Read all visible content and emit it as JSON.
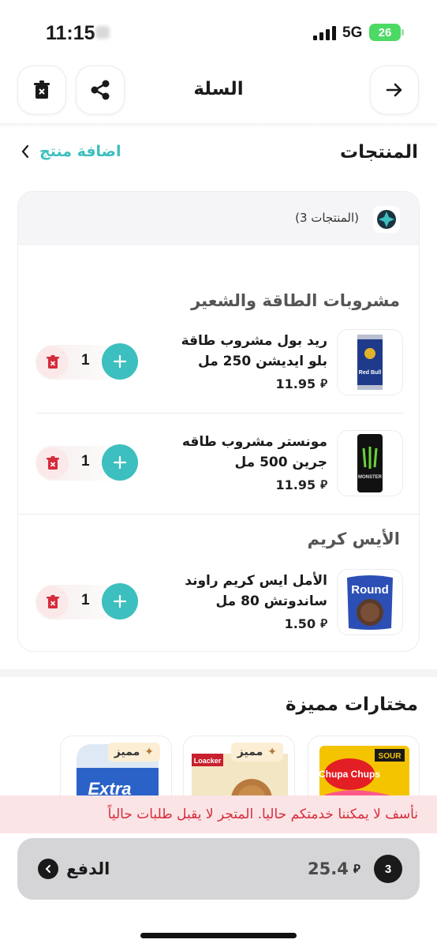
{
  "status_bar": {
    "time": "11:15",
    "network": "5G",
    "battery": "26"
  },
  "header": {
    "title": "السلة"
  },
  "products": {
    "title": "المنتجات",
    "add_label": "اضافة منتج"
  },
  "card": {
    "count_label": "(3 المنتجات)",
    "categories": [
      {
        "name": "مشروبات الطاقة والشعير",
        "items": [
          {
            "name": "ريد بول مشروب طاقة بلو ايديشن 250 مل",
            "price": "11.95",
            "qty": "1"
          },
          {
            "name": "مونستر مشروب طاقه جرين 500 مل",
            "price": "11.95",
            "qty": "1"
          }
        ]
      },
      {
        "name": "الأيس كريم",
        "items": [
          {
            "name": "الأمل ايس كريم راوند ساندوتش 80 مل",
            "price": "1.50",
            "qty": "1"
          }
        ]
      }
    ]
  },
  "featured": {
    "title": "مختارات مميزة",
    "badge": "مميز",
    "product_texts": {
      "extra": "Extra",
      "loacker": "Loacker",
      "chupa": "Chupa Chups",
      "sour": "SOUR"
    }
  },
  "product_texts": {
    "redbull": "Red Bull",
    "monster": "MONSTER",
    "round": "Round"
  },
  "notice": "نأسف لا يمكننا خدمتكم حاليا. المتجر لا يقبل طلبات حالياً",
  "checkout": {
    "count": "3",
    "total": "25.4",
    "label": "الدفع"
  },
  "currency_symbol": "⃁",
  "colors": {
    "accent": "#3dbfbf",
    "danger": "#d62b3a",
    "badge_bg": "#fbeed5"
  }
}
